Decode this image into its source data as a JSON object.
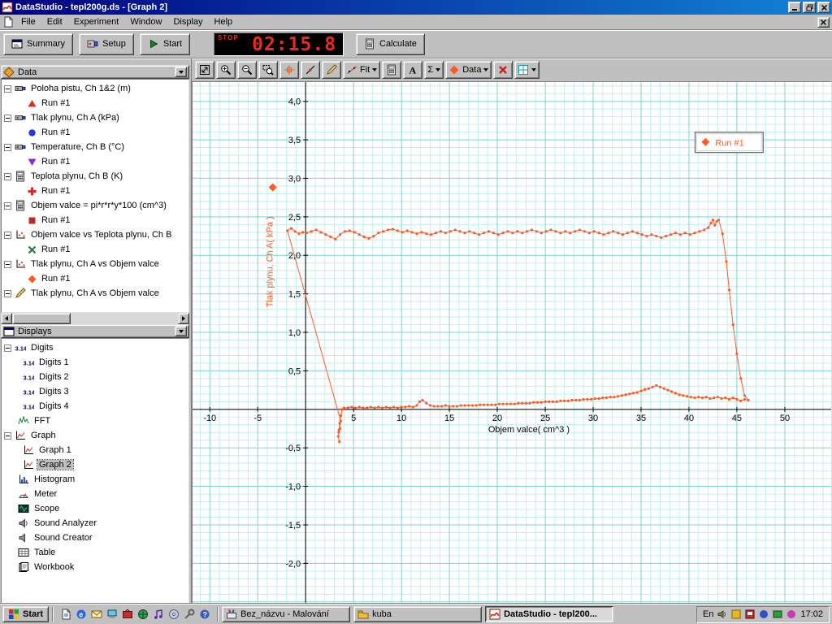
{
  "window": {
    "title": "DataStudio - tepl200g.ds - [Graph 2]",
    "menu": [
      "File",
      "Edit",
      "Experiment",
      "Window",
      "Display",
      "Help"
    ]
  },
  "toolbar": {
    "summary_label": "Summary",
    "setup_label": "Setup",
    "start_label": "Start",
    "timer_label": "STOP",
    "timer_value": "02:15.8",
    "calculate_label": "Calculate"
  },
  "graph_toolbar": {
    "buttons": [
      {
        "name": "scale-to-fit",
        "icon": "scalefit"
      },
      {
        "name": "zoom-in",
        "icon": "zoomin"
      },
      {
        "name": "zoom-out",
        "icon": "zoomout"
      },
      {
        "name": "zoom-select",
        "icon": "zoomsel"
      },
      {
        "name": "smart-tool",
        "icon": "smart"
      },
      {
        "name": "slope-tool",
        "icon": "slope"
      },
      {
        "name": "annotation-tool",
        "icon": "note"
      },
      {
        "name": "fit-menu",
        "icon": "fitline",
        "label": "Fit",
        "dropdown": true
      },
      {
        "name": "calculate-tool",
        "icon": "calc"
      },
      {
        "name": "text-tool",
        "icon": "textA"
      },
      {
        "name": "statistics-menu",
        "label": "Σ",
        "dropdown": true
      },
      {
        "name": "data-menu",
        "icon": "diamond",
        "label": "Data",
        "dropdown": true
      },
      {
        "name": "remove",
        "icon": "deletex"
      },
      {
        "name": "graph-settings",
        "icon": "gridset",
        "dropdown": true
      }
    ]
  },
  "data_panel": {
    "title": "Data",
    "items": [
      {
        "label": "Poloha pistu, Ch 1&2 (m)",
        "icon": "sensor",
        "level": 0,
        "expand": true
      },
      {
        "label": "Run #1",
        "marker": "triangle-up",
        "color": "#d83028",
        "level": 1
      },
      {
        "label": "Tlak plynu, Ch A (kPa)",
        "icon": "sensor",
        "level": 0,
        "expand": true
      },
      {
        "label": "Run #1",
        "marker": "circle",
        "color": "#2838d8",
        "level": 1
      },
      {
        "label": "Temperature, Ch B (°C)",
        "icon": "sensor",
        "level": 0,
        "expand": true
      },
      {
        "label": "Run #1",
        "marker": "triangle-down",
        "color": "#8c2cc8",
        "level": 1
      },
      {
        "label": "Teplota plynu, Ch B (K)",
        "icon": "calc",
        "level": 0,
        "expand": true
      },
      {
        "label": "Run #1",
        "marker": "plus",
        "color": "#d82828",
        "level": 1
      },
      {
        "label": "Objem valce = pi*r*r*y*100 (cm^3)",
        "icon": "calc",
        "level": 0,
        "expand": true
      },
      {
        "label": "Run #1",
        "marker": "square",
        "color": "#b03028",
        "level": 1
      },
      {
        "label": "Objem valce vs Teplota plynu, Ch B",
        "icon": "xy",
        "level": 0,
        "expand": true
      },
      {
        "label": "Run #1",
        "marker": "xmark",
        "color": "#1c8040",
        "level": 1
      },
      {
        "label": "Tlak plynu, Ch A vs Objem valce",
        "icon": "xy",
        "level": 0,
        "expand": true
      },
      {
        "label": "Run #1",
        "marker": "diamond",
        "color": "#ff5a26",
        "level": 1
      },
      {
        "label": "Tlak plynu, Ch A vs Objem valce",
        "icon": "pen",
        "level": 0,
        "expand": true
      }
    ]
  },
  "displays_panel": {
    "title": "Displays",
    "items": [
      {
        "label": "Digits",
        "icon": "digits",
        "level": 0,
        "expand": true
      },
      {
        "label": "Digits 1",
        "icon": "digits",
        "level": 1
      },
      {
        "label": "Digits 2",
        "icon": "digits",
        "level": 1
      },
      {
        "label": "Digits 3",
        "icon": "digits",
        "level": 1
      },
      {
        "label": "Digits 4",
        "icon": "digits",
        "level": 1
      },
      {
        "label": "FFT",
        "icon": "fft",
        "level": 0
      },
      {
        "label": "Graph",
        "icon": "graphicon",
        "level": 0,
        "expand": true
      },
      {
        "label": "Graph 1",
        "icon": "graphicon",
        "level": 1
      },
      {
        "label": "Graph 2",
        "icon": "graphicon",
        "level": 1,
        "selected": true
      },
      {
        "label": "Histogram",
        "icon": "histogram",
        "level": 0
      },
      {
        "label": "Meter",
        "icon": "meter",
        "level": 0
      },
      {
        "label": "Scope",
        "icon": "scope",
        "level": 0
      },
      {
        "label": "Sound Analyzer",
        "icon": "speaker2",
        "level": 0
      },
      {
        "label": "Sound Creator",
        "icon": "speaker",
        "level": 0
      },
      {
        "label": "Table",
        "icon": "tableicon",
        "level": 0
      },
      {
        "label": "Workbook",
        "icon": "workbook",
        "level": 0
      }
    ]
  },
  "taskbar": {
    "start_label": "Start",
    "quicklaunch": [
      "doc",
      "ie",
      "mail",
      "desk",
      "tv",
      "globe",
      "music",
      "cd",
      "tool",
      "help"
    ],
    "tasks": [
      {
        "label": "Bez_názvu - Malování",
        "icon": "paint",
        "active": false
      },
      {
        "label": "kuba",
        "icon": "folder",
        "active": false
      },
      {
        "label": "DataStudio - tepl200...",
        "icon": "datastudio",
        "active": true
      }
    ],
    "tray": {
      "lang": "En",
      "icons": [
        "volume",
        "tray1",
        "tray2",
        "tray3",
        "tray4",
        "tray5"
      ],
      "time": "17:02"
    }
  },
  "chart_data": {
    "type": "scatter",
    "series_name": "Run #1",
    "series_color": "#ff5a26",
    "xlabel": "Objem valce( cm^3 )",
    "ylabel": "Tlak plynu, Ch A( kPa )",
    "xlim": [
      -11.8,
      54.84
    ],
    "ylim": [
      -2.513,
      4.25
    ],
    "x_ticks": [
      -10,
      -5,
      5,
      10,
      15,
      20,
      25,
      30,
      35,
      40,
      45,
      50
    ],
    "y_ticks": [
      [
        4,
        "4,0"
      ],
      [
        3.5,
        "3,5"
      ],
      [
        3,
        "3,0"
      ],
      [
        2.5,
        "2,5"
      ],
      [
        2,
        "2,0"
      ],
      [
        1.5,
        "1,5"
      ],
      [
        1,
        "1,0"
      ],
      [
        0.5,
        "0,5"
      ],
      [
        -0.5,
        "-0,5"
      ],
      [
        -1,
        "-1,0"
      ],
      [
        -1.5,
        "-1,5"
      ],
      [
        -2,
        "-2,0"
      ]
    ],
    "grid": {
      "minor_step_x": 1,
      "minor_step_y": 0.1,
      "major_step_x": 5,
      "major_step_y": 0.5,
      "minor_color": "#c2eeee",
      "major_color": "#7ed3d3"
    },
    "legend": {
      "label": "Run #1"
    },
    "points": [
      [
        3.52,
        -0.42
      ],
      [
        3.4,
        -0.35
      ],
      [
        3.58,
        -0.25
      ],
      [
        3.46,
        -0.3
      ],
      [
        3.66,
        -0.15
      ],
      [
        -1.9,
        2.32
      ],
      [
        -1.5,
        2.35
      ],
      [
        -1.1,
        2.31
      ],
      [
        -0.7,
        2.28
      ],
      [
        -0.3,
        2.3
      ],
      [
        0.1,
        2.29
      ],
      [
        0.6,
        2.31
      ],
      [
        1.1,
        2.33
      ],
      [
        1.6,
        2.3
      ],
      [
        2.1,
        2.27
      ],
      [
        2.6,
        2.24
      ],
      [
        3.1,
        2.21
      ],
      [
        3.6,
        2.27
      ],
      [
        4.1,
        2.31
      ],
      [
        4.6,
        2.32
      ],
      [
        5.1,
        2.3
      ],
      [
        5.6,
        2.27
      ],
      [
        6.1,
        2.24
      ],
      [
        6.6,
        2.22
      ],
      [
        7.1,
        2.25
      ],
      [
        7.6,
        2.29
      ],
      [
        8.1,
        2.31
      ],
      [
        8.6,
        2.33
      ],
      [
        9.1,
        2.34
      ],
      [
        9.6,
        2.32
      ],
      [
        10.1,
        2.3
      ],
      [
        10.6,
        2.32
      ],
      [
        11.1,
        2.3
      ],
      [
        11.6,
        2.28
      ],
      [
        12.1,
        2.3
      ],
      [
        12.6,
        2.28
      ],
      [
        13.1,
        2.27
      ],
      [
        13.6,
        2.29
      ],
      [
        14.1,
        2.31
      ],
      [
        14.6,
        2.29
      ],
      [
        15.1,
        2.31
      ],
      [
        15.6,
        2.33
      ],
      [
        16.1,
        2.31
      ],
      [
        16.6,
        2.29
      ],
      [
        17.1,
        2.31
      ],
      [
        17.6,
        2.29
      ],
      [
        18.1,
        2.27
      ],
      [
        18.6,
        2.29
      ],
      [
        19.1,
        2.31
      ],
      [
        19.6,
        2.29
      ],
      [
        20.1,
        2.27
      ],
      [
        20.6,
        2.29
      ],
      [
        21.1,
        2.31
      ],
      [
        21.6,
        2.29
      ],
      [
        22.1,
        2.31
      ],
      [
        22.6,
        2.29
      ],
      [
        23.1,
        2.31
      ],
      [
        23.6,
        2.33
      ],
      [
        24.1,
        2.31
      ],
      [
        24.6,
        2.29
      ],
      [
        25.1,
        2.31
      ],
      [
        25.6,
        2.33
      ],
      [
        26.1,
        2.31
      ],
      [
        26.6,
        2.29
      ],
      [
        27.1,
        2.31
      ],
      [
        27.6,
        2.29
      ],
      [
        28.1,
        2.31
      ],
      [
        28.6,
        2.33
      ],
      [
        29.1,
        2.31
      ],
      [
        29.6,
        2.29
      ],
      [
        30.1,
        2.31
      ],
      [
        30.6,
        2.29
      ],
      [
        31.1,
        2.27
      ],
      [
        31.6,
        2.29
      ],
      [
        32.1,
        2.31
      ],
      [
        32.6,
        2.29
      ],
      [
        33.1,
        2.27
      ],
      [
        33.6,
        2.29
      ],
      [
        34.1,
        2.31
      ],
      [
        34.6,
        2.29
      ],
      [
        35.1,
        2.27
      ],
      [
        35.6,
        2.25
      ],
      [
        36.1,
        2.27
      ],
      [
        36.6,
        2.25
      ],
      [
        37.1,
        2.23
      ],
      [
        37.6,
        2.25
      ],
      [
        38.1,
        2.27
      ],
      [
        38.6,
        2.29
      ],
      [
        39.1,
        2.27
      ],
      [
        39.6,
        2.29
      ],
      [
        40.1,
        2.27
      ],
      [
        40.6,
        2.29
      ],
      [
        41.1,
        2.31
      ],
      [
        41.6,
        2.33
      ],
      [
        42,
        2.36
      ],
      [
        42.3,
        2.42
      ],
      [
        42.5,
        2.46
      ],
      [
        42.7,
        2.39
      ],
      [
        42.9,
        2.44
      ],
      [
        43.1,
        2.46
      ],
      [
        43.5,
        2.28
      ],
      [
        43.9,
        1.92
      ],
      [
        44.2,
        1.55
      ],
      [
        44.6,
        1.1
      ],
      [
        45,
        0.72
      ],
      [
        45.4,
        0.4
      ],
      [
        45.8,
        0.18
      ],
      [
        46.2,
        0.12
      ],
      [
        45.8,
        0.13
      ],
      [
        45.4,
        0.11
      ],
      [
        45,
        0.13
      ],
      [
        44.6,
        0.15
      ],
      [
        44.2,
        0.13
      ],
      [
        43.8,
        0.15
      ],
      [
        43.4,
        0.14
      ],
      [
        43,
        0.16
      ],
      [
        42.6,
        0.15
      ],
      [
        42.2,
        0.14
      ],
      [
        41.8,
        0.16
      ],
      [
        41.4,
        0.15
      ],
      [
        41,
        0.16
      ],
      [
        40.6,
        0.15
      ],
      [
        40.2,
        0.16
      ],
      [
        39.8,
        0.17
      ],
      [
        39.4,
        0.18
      ],
      [
        39,
        0.19
      ],
      [
        38.6,
        0.21
      ],
      [
        38.2,
        0.23
      ],
      [
        37.8,
        0.25
      ],
      [
        37.4,
        0.27
      ],
      [
        37,
        0.29
      ],
      [
        36.6,
        0.31
      ],
      [
        36.2,
        0.29
      ],
      [
        35.8,
        0.27
      ],
      [
        35.4,
        0.26
      ],
      [
        35,
        0.24
      ],
      [
        34.6,
        0.22
      ],
      [
        34.2,
        0.21
      ],
      [
        33.8,
        0.2
      ],
      [
        33.4,
        0.19
      ],
      [
        33,
        0.18
      ],
      [
        32.6,
        0.17
      ],
      [
        32.2,
        0.16
      ],
      [
        31.8,
        0.16
      ],
      [
        31.4,
        0.15
      ],
      [
        31,
        0.15
      ],
      [
        30.6,
        0.14
      ],
      [
        30.2,
        0.14
      ],
      [
        29.8,
        0.13
      ],
      [
        29.4,
        0.13
      ],
      [
        29,
        0.13
      ],
      [
        28.6,
        0.12
      ],
      [
        28.2,
        0.12
      ],
      [
        27.8,
        0.12
      ],
      [
        27.4,
        0.11
      ],
      [
        27,
        0.11
      ],
      [
        26.6,
        0.11
      ],
      [
        26.2,
        0.1
      ],
      [
        25.8,
        0.1
      ],
      [
        25.4,
        0.1
      ],
      [
        25,
        0.1
      ],
      [
        24.6,
        0.09
      ],
      [
        24.2,
        0.09
      ],
      [
        23.8,
        0.09
      ],
      [
        23.4,
        0.08
      ],
      [
        23,
        0.08
      ],
      [
        22.6,
        0.08
      ],
      [
        22.2,
        0.08
      ],
      [
        21.8,
        0.07
      ],
      [
        21.4,
        0.07
      ],
      [
        21,
        0.07
      ],
      [
        20.6,
        0.07
      ],
      [
        20.2,
        0.07
      ],
      [
        19.8,
        0.06
      ],
      [
        19.4,
        0.06
      ],
      [
        19,
        0.06
      ],
      [
        18.6,
        0.06
      ],
      [
        18.2,
        0.06
      ],
      [
        17.8,
        0.05
      ],
      [
        17.4,
        0.05
      ],
      [
        17,
        0.05
      ],
      [
        16.6,
        0.05
      ],
      [
        16.2,
        0.05
      ],
      [
        15.8,
        0.04
      ],
      [
        15.4,
        0.04
      ],
      [
        15,
        0.04
      ],
      [
        14.6,
        0.05
      ],
      [
        14.2,
        0.04
      ],
      [
        13.8,
        0.04
      ],
      [
        13.4,
        0.04
      ],
      [
        13,
        0.05
      ],
      [
        12.6,
        0.08
      ],
      [
        12.2,
        0.12
      ],
      [
        11.9,
        0.1
      ],
      [
        11.6,
        0.05
      ],
      [
        11.2,
        0.03
      ],
      [
        10.8,
        0.04
      ],
      [
        10.4,
        0.03
      ],
      [
        10,
        0.03
      ],
      [
        9.6,
        0.02
      ],
      [
        9.2,
        0.03
      ],
      [
        8.8,
        0.02
      ],
      [
        8.4,
        0.03
      ],
      [
        8,
        0.02
      ],
      [
        7.6,
        0.03
      ],
      [
        7.2,
        0.02
      ],
      [
        6.8,
        0.03
      ],
      [
        6.4,
        0.02
      ],
      [
        6,
        0.02
      ],
      [
        5.6,
        0.03
      ],
      [
        5.2,
        0.02
      ],
      [
        4.8,
        0.03
      ],
      [
        4.4,
        0.02
      ],
      [
        4,
        0.02
      ],
      [
        3.8,
        0
      ],
      [
        3.68,
        -0.08
      ],
      [
        3.56,
        -0.18
      ],
      [
        3.47,
        -0.27
      ]
    ]
  }
}
